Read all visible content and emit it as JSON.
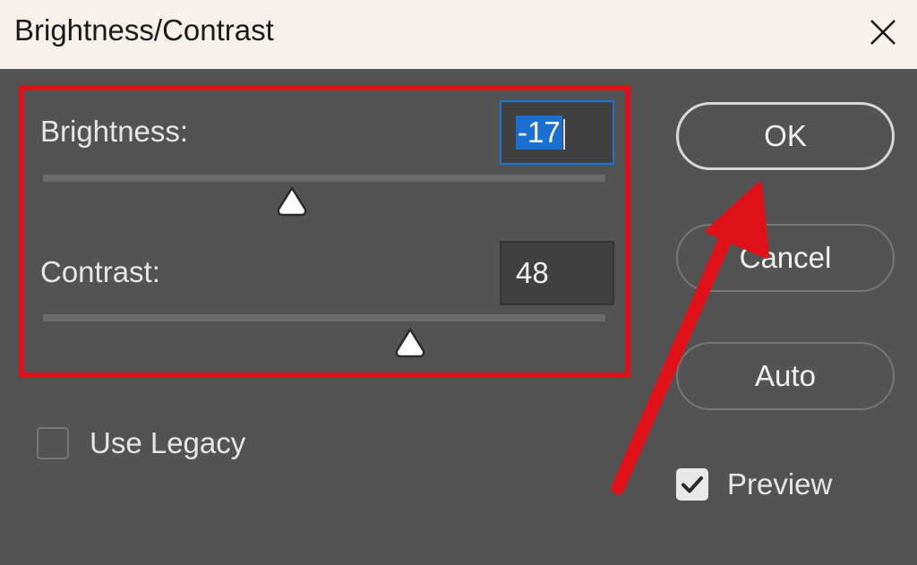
{
  "window": {
    "title": "Brightness/Contrast"
  },
  "icons": {
    "close": "close-icon",
    "check": "check-icon",
    "slider_thumb": "triangle-thumb-icon"
  },
  "fields": {
    "brightness": {
      "label": "Brightness:",
      "value": "-17",
      "min": -150,
      "max": 150,
      "focused": true
    },
    "contrast": {
      "label": "Contrast:",
      "value": "48",
      "min": -50,
      "max": 100,
      "focused": false
    }
  },
  "buttons": {
    "ok": "OK",
    "cancel": "Cancel",
    "auto": "Auto"
  },
  "options": {
    "use_legacy": {
      "label": "Use Legacy",
      "checked": false
    },
    "preview": {
      "label": "Preview",
      "checked": true
    }
  },
  "colors": {
    "dialog_bg": "#535353",
    "titlebar_bg": "#f7f1ea",
    "annotation_red": "#e1111a",
    "focus_blue": "#1f74cd",
    "selection_blue": "#1a6fd0"
  }
}
